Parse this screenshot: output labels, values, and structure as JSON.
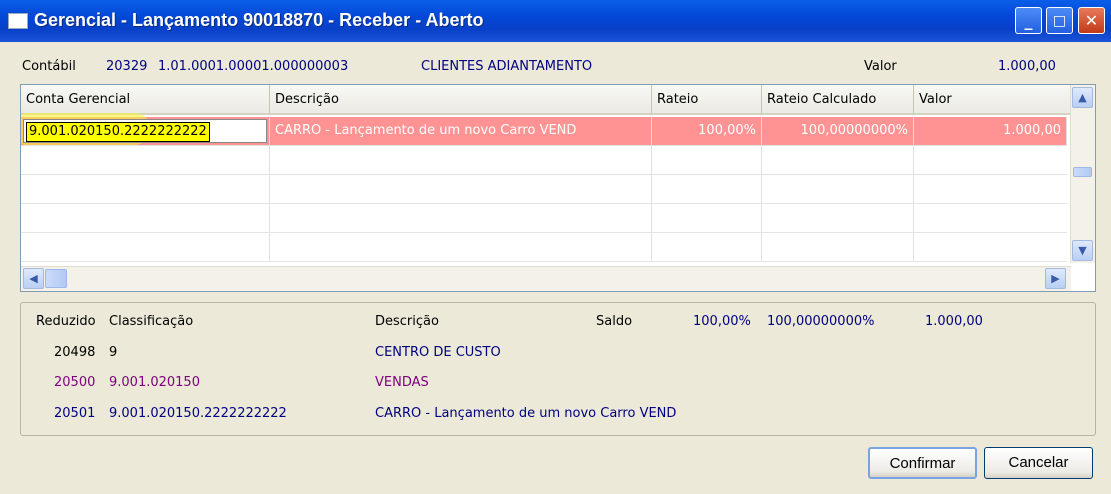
{
  "window": {
    "title": "Gerencial -  Lançamento 90018870 - Receber - Aberto",
    "minimize": "_",
    "maximize": "□",
    "close": "✕"
  },
  "header": {
    "contabil_label": "Contábil",
    "contabil_code": "20329",
    "contabil_account": "1.01.0001.00001.000000003",
    "contabil_name": "CLIENTES ADIANTAMENTO",
    "valor_label": "Valor",
    "valor_value": "1.000,00"
  },
  "grid": {
    "columns": [
      "Conta Gerencial",
      "Descrição",
      "Rateio",
      "Rateio Calculado",
      "Valor"
    ],
    "rows": [
      {
        "conta": "9.001.020150.2222222222",
        "descricao": "CARRO - Lançamento de um novo Carro VEND",
        "rateio": "100,00%",
        "rateio_calc": "100,00000000%",
        "valor": "1.000,00",
        "selected": true
      }
    ],
    "scroll_up": "▲",
    "scroll_down": "▼",
    "scroll_left": "◀",
    "scroll_right": "▶"
  },
  "detail": {
    "headers": {
      "reduzido": "Reduzido",
      "classificacao": "Classificação",
      "descricao": "Descrição",
      "saldo": "Saldo",
      "saldo_pct": "100,00%",
      "saldo_calc": "100,00000000%",
      "saldo_valor": "1.000,00"
    },
    "rows": [
      {
        "reduzido": "20498",
        "classificacao": "9",
        "descricao": "CENTRO DE CUSTO"
      },
      {
        "reduzido": "20500",
        "classificacao": "9.001.020150",
        "descricao": "VENDAS"
      },
      {
        "reduzido": "20501",
        "classificacao": "9.001.020150.2222222222",
        "descricao": "CARRO - Lançamento de um novo Carro VEND"
      }
    ]
  },
  "buttons": {
    "confirmar": "Confirmar",
    "cancelar": "Cancelar"
  }
}
